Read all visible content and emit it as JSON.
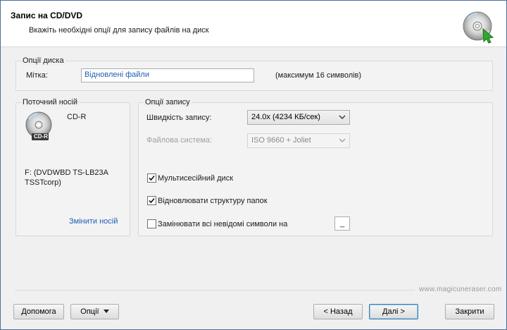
{
  "header": {
    "title": "Запис на CD/DVD",
    "subtitle": "Вкажіть необхідні опції для запису файлів на диск",
    "icon": "cd-burn-icon"
  },
  "disk_options": {
    "group_title": "Опції диска",
    "label_caption": "Мітка:",
    "label_value": "Відновлені файли",
    "label_hint": "(максимум 16 символів)"
  },
  "current_media": {
    "group_title": "Поточний носій",
    "media_type": "CD-R",
    "disc_badge": "CD-R",
    "drive_line1": "F: (DVDWBD TS-LB23A",
    "drive_line2": "TSSTcorp)",
    "change_link": "Змінити носій"
  },
  "write_options": {
    "group_title": "Опції запису",
    "speed_label": "Швидкість запису:",
    "speed_value": "24.0x (4234 КБ/сек)",
    "fs_label": "Файлова система:",
    "fs_value": "ISO 9660 + Joliet",
    "multisession_label": "Мультисесійний диск",
    "multisession_checked": true,
    "restore_structure_label": "Відновлювати структуру папок",
    "restore_structure_checked": true,
    "replace_unknown_label": "Замінювати всі невідомі символи на",
    "replace_unknown_checked": false,
    "replace_char": "_"
  },
  "footer": {
    "url": "www.magicuneraser.com",
    "help_button": "Допомога",
    "options_button": "Опції",
    "back_button": "< Назад",
    "next_button": "Далі >",
    "close_button": "Закрити"
  }
}
